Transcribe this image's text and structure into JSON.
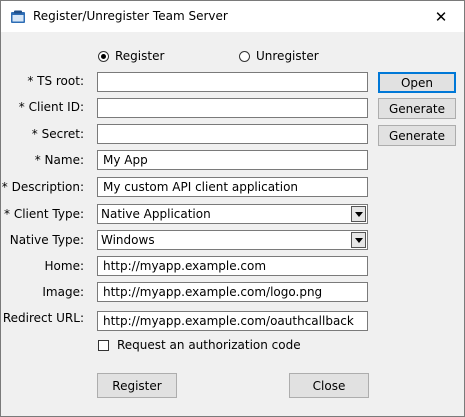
{
  "window": {
    "title": "Register/Unregister Team Server",
    "close_glyph": "✕"
  },
  "mode": {
    "options": [
      {
        "label": "Register",
        "selected": true
      },
      {
        "label": "Unregister",
        "selected": false
      }
    ]
  },
  "form": {
    "ts_root": {
      "label": "* TS root:",
      "value": ""
    },
    "client_id": {
      "label": "* Client ID:",
      "value": ""
    },
    "secret": {
      "label": "* Secret:",
      "value": ""
    },
    "name": {
      "label": "* Name:",
      "value": "My App"
    },
    "description": {
      "label": "* Description:",
      "value": "My custom API client application"
    },
    "client_type": {
      "label": "* Client Type:",
      "value": "Native Application"
    },
    "native_type": {
      "label": "Native Type:",
      "value": "Windows"
    },
    "home": {
      "label": "Home:",
      "value": "http://myapp.example.com"
    },
    "image": {
      "label": "Image:",
      "value": "http://myapp.example.com/logo.png"
    },
    "redirect_url": {
      "label": "Redirect URL:",
      "value": "http://myapp.example.com/oauthcallback"
    },
    "auth_code": {
      "label": "Request an authorization code",
      "checked": false
    }
  },
  "buttons": {
    "open": "Open",
    "generate_client_id": "Generate",
    "generate_secret": "Generate",
    "register": "Register",
    "close": "Close"
  }
}
